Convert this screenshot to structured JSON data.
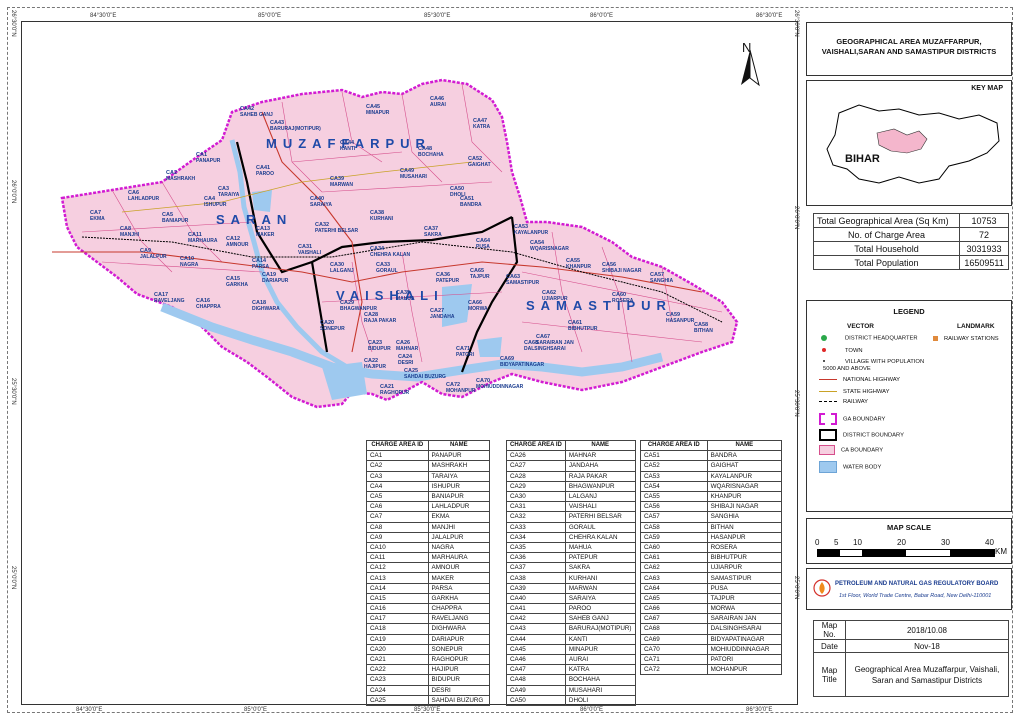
{
  "coords": {
    "top": [
      "84°30'0\"E",
      "85°0'0\"E",
      "85°30'0\"E",
      "86°0'0\"E",
      "86°30'0\"E"
    ],
    "bottom": [
      "84°30'0\"E",
      "85°0'0\"E",
      "85°30'0\"E",
      "86°0'0\"E",
      "86°30'0\"E"
    ],
    "left": [
      "26°30'0\"N",
      "26°0'0\"N",
      "25°30'0\"N",
      "25°0'0\"N"
    ],
    "right": [
      "26°30'0\"N",
      "26°0'0\"N",
      "25°30'0\"N",
      "25°0'0\"N"
    ]
  },
  "north": "N",
  "districts": {
    "muzaffarpur": "MUZAFFARPUR",
    "saran": "SARAN",
    "vaishali": "VAISHALI",
    "samastipur": "SAMASTIPUR"
  },
  "map_labels": [
    {
      "id": "CA46",
      "name": "AURAI"
    },
    {
      "id": "CA45",
      "name": "MINAPUR"
    },
    {
      "id": "CA42",
      "name": "SAHEB GANJ"
    },
    {
      "id": "CA47",
      "name": "KATRA"
    },
    {
      "id": "CA43",
      "name": "BARURAJ(MOTIPUR)"
    },
    {
      "id": "CA1",
      "name": "PANAPUR"
    },
    {
      "id": "CA48",
      "name": "BOCHAHA"
    },
    {
      "id": "CA52",
      "name": "GAIGHAT"
    },
    {
      "id": "CA41",
      "name": "PAROO"
    },
    {
      "id": "CA49",
      "name": "MUSAHARI"
    },
    {
      "id": "CA2",
      "name": "MASHRAKH"
    },
    {
      "id": "CA39",
      "name": "MARWAN"
    },
    {
      "id": "CA3",
      "name": "TARAIYA"
    },
    {
      "id": "CA6",
      "name": "LAHLADPUR"
    },
    {
      "id": "CA40",
      "name": "SARAIYA"
    },
    {
      "id": "CA51",
      "name": "BANDRA"
    },
    {
      "id": "CA5",
      "name": "BANIAPUR"
    },
    {
      "id": "CA38",
      "name": "KURHANI"
    },
    {
      "id": "CA7",
      "name": "EKMA"
    },
    {
      "id": "CA13",
      "name": "MAKER"
    },
    {
      "id": "CA32",
      "name": "PATERHI BELSAR"
    },
    {
      "id": "CA37",
      "name": "SAKRA"
    },
    {
      "id": "CA53",
      "name": "KAYALANPUR"
    },
    {
      "id": "CA11",
      "name": "MARHAURA"
    },
    {
      "id": "CA12",
      "name": "AMNOUR"
    },
    {
      "id": "CA64",
      "name": "PUSA"
    },
    {
      "id": "CA54",
      "name": "WQARISNAGAR"
    },
    {
      "id": "CA31",
      "name": "VAISHALI"
    },
    {
      "id": "CA34",
      "name": "CHEHRA KALAN"
    },
    {
      "id": "CA9",
      "name": "JALALPUR"
    },
    {
      "id": "CA10",
      "name": "NAGRA"
    },
    {
      "id": "CA14",
      "name": "PARSA"
    },
    {
      "id": "CA55",
      "name": "KHANPUR"
    },
    {
      "id": "CA56",
      "name": "SHIBAJI NAGAR"
    },
    {
      "id": "CA15",
      "name": "GARKHA"
    },
    {
      "id": "CA36",
      "name": "PATEPUR"
    },
    {
      "id": "CA65",
      "name": "TAJPUR"
    },
    {
      "id": "CA63",
      "name": "SAMASTIPUR"
    },
    {
      "id": "CA57",
      "name": "SANGHIA"
    },
    {
      "id": "CA17",
      "name": "RAVELJANG"
    },
    {
      "id": "CA16",
      "name": "CHAPPRA"
    },
    {
      "id": "CA62",
      "name": "UJIARPUR"
    },
    {
      "id": "CA60",
      "name": "ROSERA"
    },
    {
      "id": "CA18",
      "name": "DIGHWARA"
    },
    {
      "id": "CA28",
      "name": "RAJA PAKAR"
    },
    {
      "id": "CA27",
      "name": "JANDAHA"
    },
    {
      "id": "CA61",
      "name": "BIBHUTPUR"
    },
    {
      "id": "CA59",
      "name": "HASANPUR"
    },
    {
      "id": "CA58",
      "name": "BITHAN"
    },
    {
      "id": "CA67",
      "name": "SARAIRAN JAN"
    },
    {
      "id": "CA23",
      "name": "BIDUPUR"
    },
    {
      "id": "CA71",
      "name": "PATORI"
    },
    {
      "id": "CA69",
      "name": "BIDYAPATINAGAR"
    },
    {
      "id": "CA70",
      "name": "MOHIUDDINNAGAR"
    },
    {
      "id": "CA72",
      "name": "MOHANPUR"
    },
    {
      "id": "CA21",
      "name": "RAGHOPUR"
    },
    {
      "id": "CA22",
      "name": "HAJIPUR"
    },
    {
      "id": "CA24",
      "name": "DESRI"
    },
    {
      "id": "CA25",
      "name": "SAHDAI BUZURG"
    },
    {
      "id": "CA19",
      "name": "DARIAPUR"
    },
    {
      "id": "CA20",
      "name": "SONEPUR"
    },
    {
      "id": "CA26",
      "name": "MAHNAR"
    },
    {
      "id": "CA8",
      "name": "MANJHI"
    },
    {
      "id": "CA4",
      "name": "ISHUPUR"
    },
    {
      "id": "CA29",
      "name": "BHAGWANPUR"
    },
    {
      "id": "CA30",
      "name": "LALGANJ"
    },
    {
      "id": "CA33",
      "name": "GORAUL"
    },
    {
      "id": "CA35",
      "name": "MAHUA"
    },
    {
      "id": "CA44",
      "name": "KANTI"
    },
    {
      "id": "CA50",
      "name": "DHOLI"
    },
    {
      "id": "CA66",
      "name": "MORWA"
    },
    {
      "id": "CA68",
      "name": "DALSINGHSARAI"
    }
  ],
  "title": "GEOGRAPHICAL AREA MUZAFFARPUR, VAISHALI,SARAN AND SAMASTIPUR DISTRICTS",
  "key_map": {
    "title": "KEY MAP",
    "state": "BIHAR"
  },
  "stats": [
    {
      "label": "Total Geographical Area (Sq Km)",
      "value": "10753"
    },
    {
      "label": "No. of Charge Area",
      "value": "72"
    },
    {
      "label": "Total Household",
      "value": "3031933"
    },
    {
      "label": "Total Population",
      "value": "16509511"
    }
  ],
  "legend": {
    "title": "LEGEND",
    "vector": "VECTOR",
    "landmark": "LANDMARK",
    "items": [
      "DISTRICT HEADQUARTER",
      "TOWN",
      "VILLAGE WITH POPULATION 5000 AND ABOVE",
      "NATIONAL HIGHWAY",
      "STATE HIGHWAY",
      "RAILWAY",
      "GA BOUNDARY",
      "DISTRICT BOUNDARY",
      "CA BOUNDARY",
      "WATER BODY"
    ],
    "railway": "RAILWAY STATIONS"
  },
  "scale": {
    "title": "MAP SCALE",
    "ticks": [
      "0",
      "5",
      "10",
      "20",
      "30",
      "40"
    ],
    "unit": "KM"
  },
  "pngrb": {
    "name": "PETROLEUM AND NATURAL GAS REGULATORY BOARD",
    "address": "1st Floor, World Trade Centre, Babar Road, New Delhi-110001"
  },
  "map_info": {
    "map_no_label": "Map No.",
    "map_no": "2018/10.08",
    "date_label": "Date",
    "date": "Nov-18",
    "title_label": "Map Title",
    "title_value": "Geographical Area Muzaffarpur, Vaishali, Saran and Samastipur Districts"
  },
  "table_headers": {
    "id": "CHARGE AREA ID",
    "name": "NAME"
  },
  "tables": [
    [
      [
        "CA1",
        "PANAPUR"
      ],
      [
        "CA2",
        "MASHRAKH"
      ],
      [
        "CA3",
        "TARAIYA"
      ],
      [
        "CA4",
        "ISHUPUR"
      ],
      [
        "CA5",
        "BANIAPUR"
      ],
      [
        "CA6",
        "LAHLADPUR"
      ],
      [
        "CA7",
        "EKMA"
      ],
      [
        "CA8",
        "MANJHI"
      ],
      [
        "CA9",
        "JALALPUR"
      ],
      [
        "CA10",
        "NAGRA"
      ],
      [
        "CA11",
        "MARHAURA"
      ],
      [
        "CA12",
        "AMNOUR"
      ],
      [
        "CA13",
        "MAKER"
      ],
      [
        "CA14",
        "PARSA"
      ],
      [
        "CA15",
        "GARKHA"
      ],
      [
        "CA16",
        "CHAPPRA"
      ],
      [
        "CA17",
        "RAVELJANG"
      ],
      [
        "CA18",
        "DIGHWARA"
      ],
      [
        "CA19",
        "DARIAPUR"
      ],
      [
        "CA20",
        "SONEPUR"
      ],
      [
        "CA21",
        "RAGHOPUR"
      ],
      [
        "CA22",
        "HAJIPUR"
      ],
      [
        "CA23",
        "BIDUPUR"
      ],
      [
        "CA24",
        "DESRI"
      ],
      [
        "CA25",
        "SAHDAI BUZURG"
      ]
    ],
    [
      [
        "CA26",
        "MAHNAR"
      ],
      [
        "CA27",
        "JANDAHA"
      ],
      [
        "CA28",
        "RAJA PAKAR"
      ],
      [
        "CA29",
        "BHAGWANPUR"
      ],
      [
        "CA30",
        "LALGANJ"
      ],
      [
        "CA31",
        "VAISHALI"
      ],
      [
        "CA32",
        "PATERHI BELSAR"
      ],
      [
        "CA33",
        "GORAUL"
      ],
      [
        "CA34",
        "CHEHRA KALAN"
      ],
      [
        "CA35",
        "MAHUA"
      ],
      [
        "CA36",
        "PATEPUR"
      ],
      [
        "CA37",
        "SAKRA"
      ],
      [
        "CA38",
        "KURHANI"
      ],
      [
        "CA39",
        "MARWAN"
      ],
      [
        "CA40",
        "SARAIYA"
      ],
      [
        "CA41",
        "PAROO"
      ],
      [
        "CA42",
        "SAHEB GANJ"
      ],
      [
        "CA43",
        "BARURAJ(MOTIPUR)"
      ],
      [
        "CA44",
        "KANTI"
      ],
      [
        "CA45",
        "MINAPUR"
      ],
      [
        "CA46",
        "AURAI"
      ],
      [
        "CA47",
        "KATRA"
      ],
      [
        "CA48",
        "BOCHAHA"
      ],
      [
        "CA49",
        "MUSAHARI"
      ],
      [
        "CA50",
        "DHOLI"
      ]
    ],
    [
      [
        "CA51",
        "BANDRA"
      ],
      [
        "CA52",
        "GAIGHAT"
      ],
      [
        "CA53",
        "KAYALANPUR"
      ],
      [
        "CA54",
        "WQARISNAGAR"
      ],
      [
        "CA55",
        "KHANPUR"
      ],
      [
        "CA56",
        "SHIBAJI NAGAR"
      ],
      [
        "CA57",
        "SANGHIA"
      ],
      [
        "CA58",
        "BITHAN"
      ],
      [
        "CA59",
        "HASANPUR"
      ],
      [
        "CA60",
        "ROSERA"
      ],
      [
        "CA61",
        "BIBHUTPUR"
      ],
      [
        "CA62",
        "UJIARPUR"
      ],
      [
        "CA63",
        "SAMASTIPUR"
      ],
      [
        "CA64",
        "PUSA"
      ],
      [
        "CA65",
        "TAJPUR"
      ],
      [
        "CA66",
        "MORWA"
      ],
      [
        "CA67",
        "SARAIRAN JAN"
      ],
      [
        "CA68",
        "DALSINGHSARAI"
      ],
      [
        "CA69",
        "BIDYAPATINAGAR"
      ],
      [
        "CA70",
        "MOHIUDDINNAGAR"
      ],
      [
        "CA71",
        "PATORI"
      ],
      [
        "CA72",
        "MOHANPUR"
      ]
    ]
  ],
  "colors": {
    "ca_fill": "#f6cfe0",
    "ga_boundary": "#d21bd2",
    "water": "#9ec9ef",
    "ca_boundary": "#d64f8c",
    "text_blue": "#1a3c8f"
  }
}
